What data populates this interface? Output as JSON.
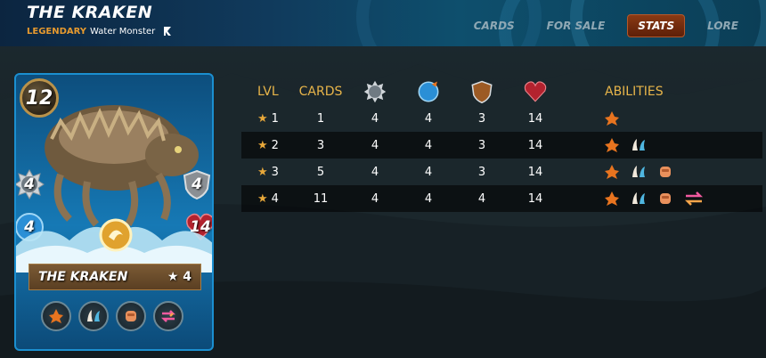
{
  "header": {
    "title": "THE KRAKEN",
    "rarity": "LEGENDARY",
    "type": "Water Monster",
    "edition_icon": "untamed-edition-icon"
  },
  "nav": {
    "tabs": [
      {
        "label": "CARDS",
        "active": false
      },
      {
        "label": "FOR SALE",
        "active": false
      },
      {
        "label": "STATS",
        "active": true
      },
      {
        "label": "LORE",
        "active": false
      }
    ]
  },
  "card": {
    "name": "THE KRAKEN",
    "level_label": "★ 4",
    "mana": "12",
    "melee": "4",
    "armor": "4",
    "speed": "4",
    "health": "14",
    "element_color": "#1679b5",
    "abilities": [
      "stun-icon",
      "reach-icon",
      "knockout-icon",
      "thorns-icon"
    ]
  },
  "stats": {
    "headers": {
      "lvl": "LVL",
      "cards": "CARDS",
      "melee_icon": "melee-attack-icon",
      "speed_icon": "speed-icon",
      "armor_icon": "armor-icon",
      "health_icon": "health-icon",
      "abilities": "ABILITIES"
    },
    "rows": [
      {
        "lvl": "1",
        "cards": "1",
        "melee": "4",
        "speed": "4",
        "armor": "3",
        "health": "14",
        "abilities": [
          "stun-icon"
        ]
      },
      {
        "lvl": "2",
        "cards": "3",
        "melee": "4",
        "speed": "4",
        "armor": "3",
        "health": "14",
        "abilities": [
          "stun-icon",
          "reach-icon"
        ]
      },
      {
        "lvl": "3",
        "cards": "5",
        "melee": "4",
        "speed": "4",
        "armor": "3",
        "health": "14",
        "abilities": [
          "stun-icon",
          "reach-icon",
          "knockout-icon"
        ]
      },
      {
        "lvl": "4",
        "cards": "11",
        "melee": "4",
        "speed": "4",
        "armor": "4",
        "health": "14",
        "abilities": [
          "stun-icon",
          "reach-icon",
          "knockout-icon",
          "thorns-icon"
        ]
      }
    ]
  }
}
